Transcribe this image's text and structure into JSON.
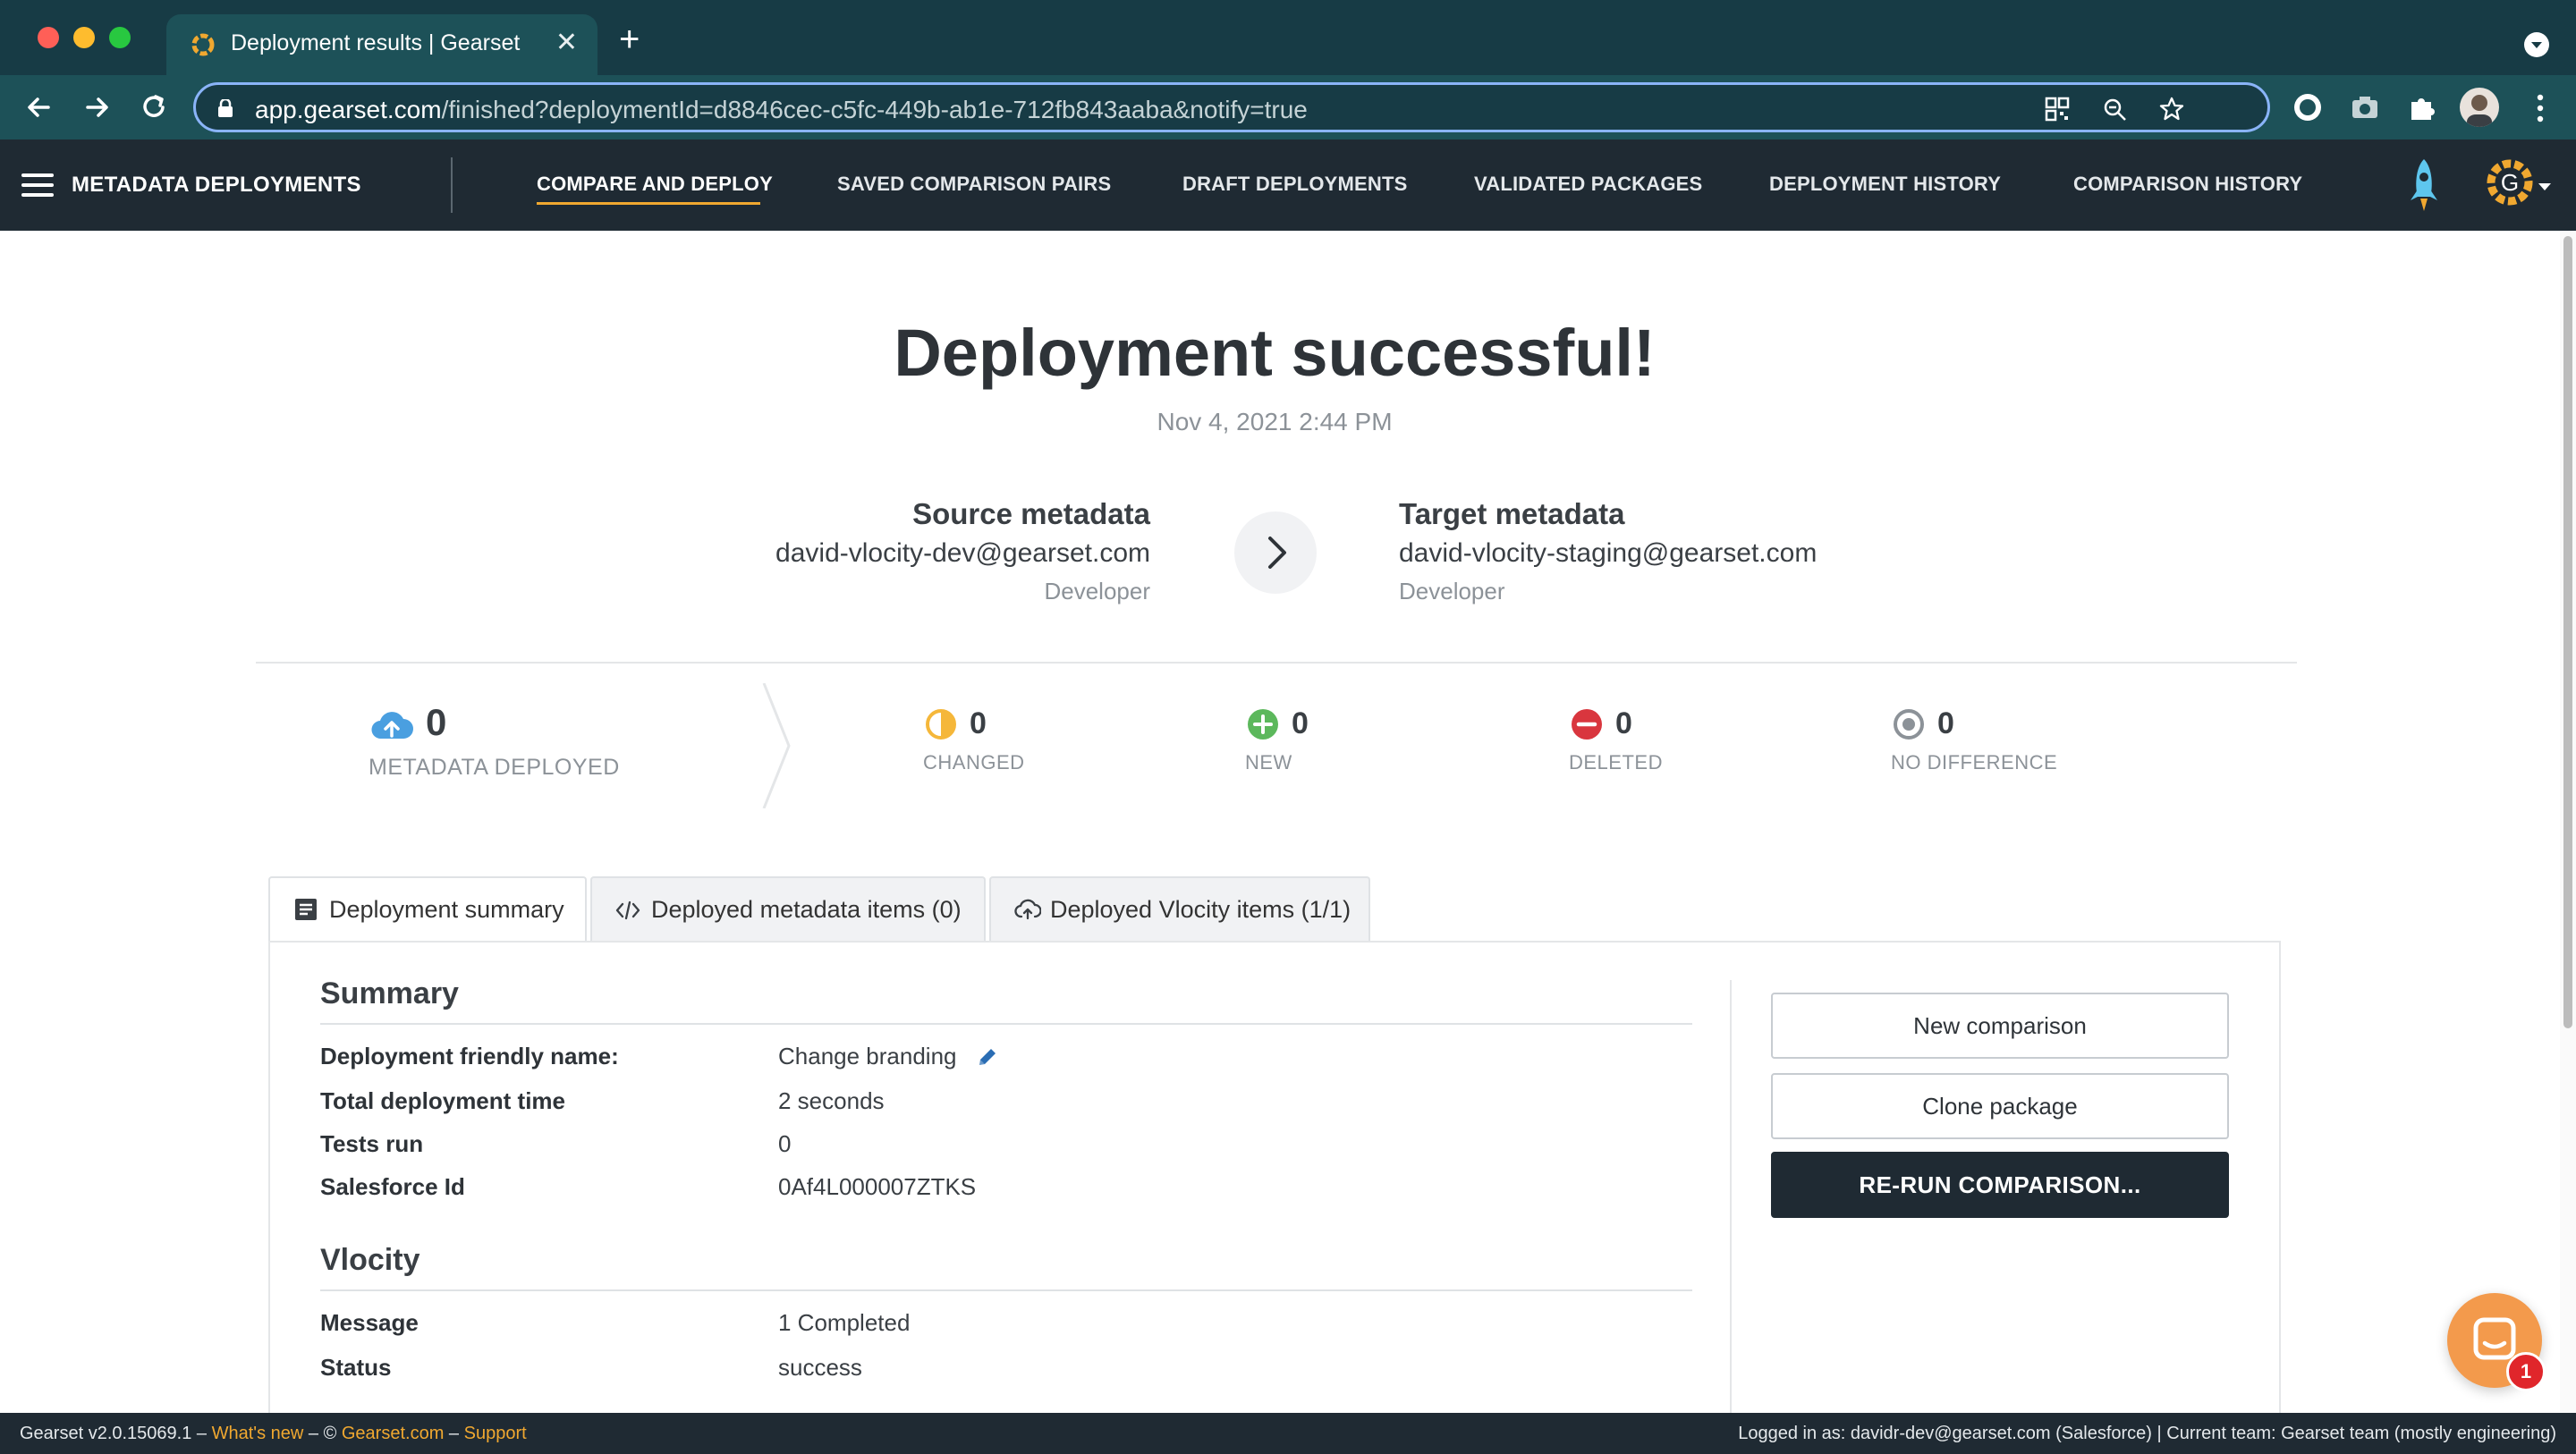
{
  "browser": {
    "tab_title": "Deployment results | Gearset",
    "url_host": "app.gearset.com",
    "url_path": "/finished?deploymentId=d8846cec-c5fc-449b-ab1e-712fb843aaba&notify=true"
  },
  "nav": {
    "app_title": "METADATA DEPLOYMENTS",
    "items": [
      "COMPARE AND DEPLOY",
      "SAVED COMPARISON PAIRS",
      "DRAFT DEPLOYMENTS",
      "VALIDATED PACKAGES",
      "DEPLOYMENT HISTORY",
      "COMPARISON HISTORY"
    ],
    "active_index": 0,
    "avatar_letter": "G"
  },
  "hero": {
    "title": "Deployment successful!",
    "date": "Nov 4, 2021 2:44 PM",
    "source": {
      "label": "Source metadata",
      "user": "david-vlocity-dev@gearset.com",
      "type": "Developer"
    },
    "target": {
      "label": "Target metadata",
      "user": "david-vlocity-staging@gearset.com",
      "type": "Developer"
    }
  },
  "stats": {
    "deployed": {
      "value": "0",
      "label": "METADATA DEPLOYED"
    },
    "changed": {
      "value": "0",
      "label": "CHANGED"
    },
    "new": {
      "value": "0",
      "label": "NEW"
    },
    "deleted": {
      "value": "0",
      "label": "DELETED"
    },
    "no_difference": {
      "value": "0",
      "label": "NO DIFFERENCE"
    }
  },
  "tabs": [
    "Deployment summary",
    "Deployed metadata items (0)",
    "Deployed Vlocity items (1/1)"
  ],
  "summary": {
    "title": "Summary",
    "rows": [
      {
        "key": "Deployment friendly name:",
        "value": "Change branding"
      },
      {
        "key": "Total deployment time",
        "value": "2 seconds"
      },
      {
        "key": "Tests run",
        "value": "0"
      },
      {
        "key": "Salesforce Id",
        "value": "0Af4L000007ZTKS"
      }
    ]
  },
  "vlocity": {
    "title": "Vlocity",
    "rows": [
      {
        "key": "Message",
        "value": "1 Completed"
      },
      {
        "key": "Status",
        "value": "success"
      }
    ]
  },
  "actions": {
    "new_comparison": "New comparison",
    "clone_package": "Clone package",
    "rerun": "RE-RUN COMPARISON..."
  },
  "chat": {
    "badge": "1"
  },
  "footer": {
    "version": "Gearset v2.0.15069.1 – ",
    "whats_new": "What's new",
    "sep1": " – © ",
    "site": "Gearset.com",
    "sep2": " – ",
    "support": "Support",
    "right": "Logged in as: davidr-dev@gearset.com (Salesforce) | Current team: Gearset team (mostly engineering)"
  },
  "colors": {
    "nav_bg": "#1f2a33",
    "accent": "#f0a830",
    "changed": "#f5b73a",
    "new": "#5cb85c",
    "deleted": "#d9363e",
    "no_difference": "#8c9298",
    "deployed": "#4a9fe0"
  }
}
